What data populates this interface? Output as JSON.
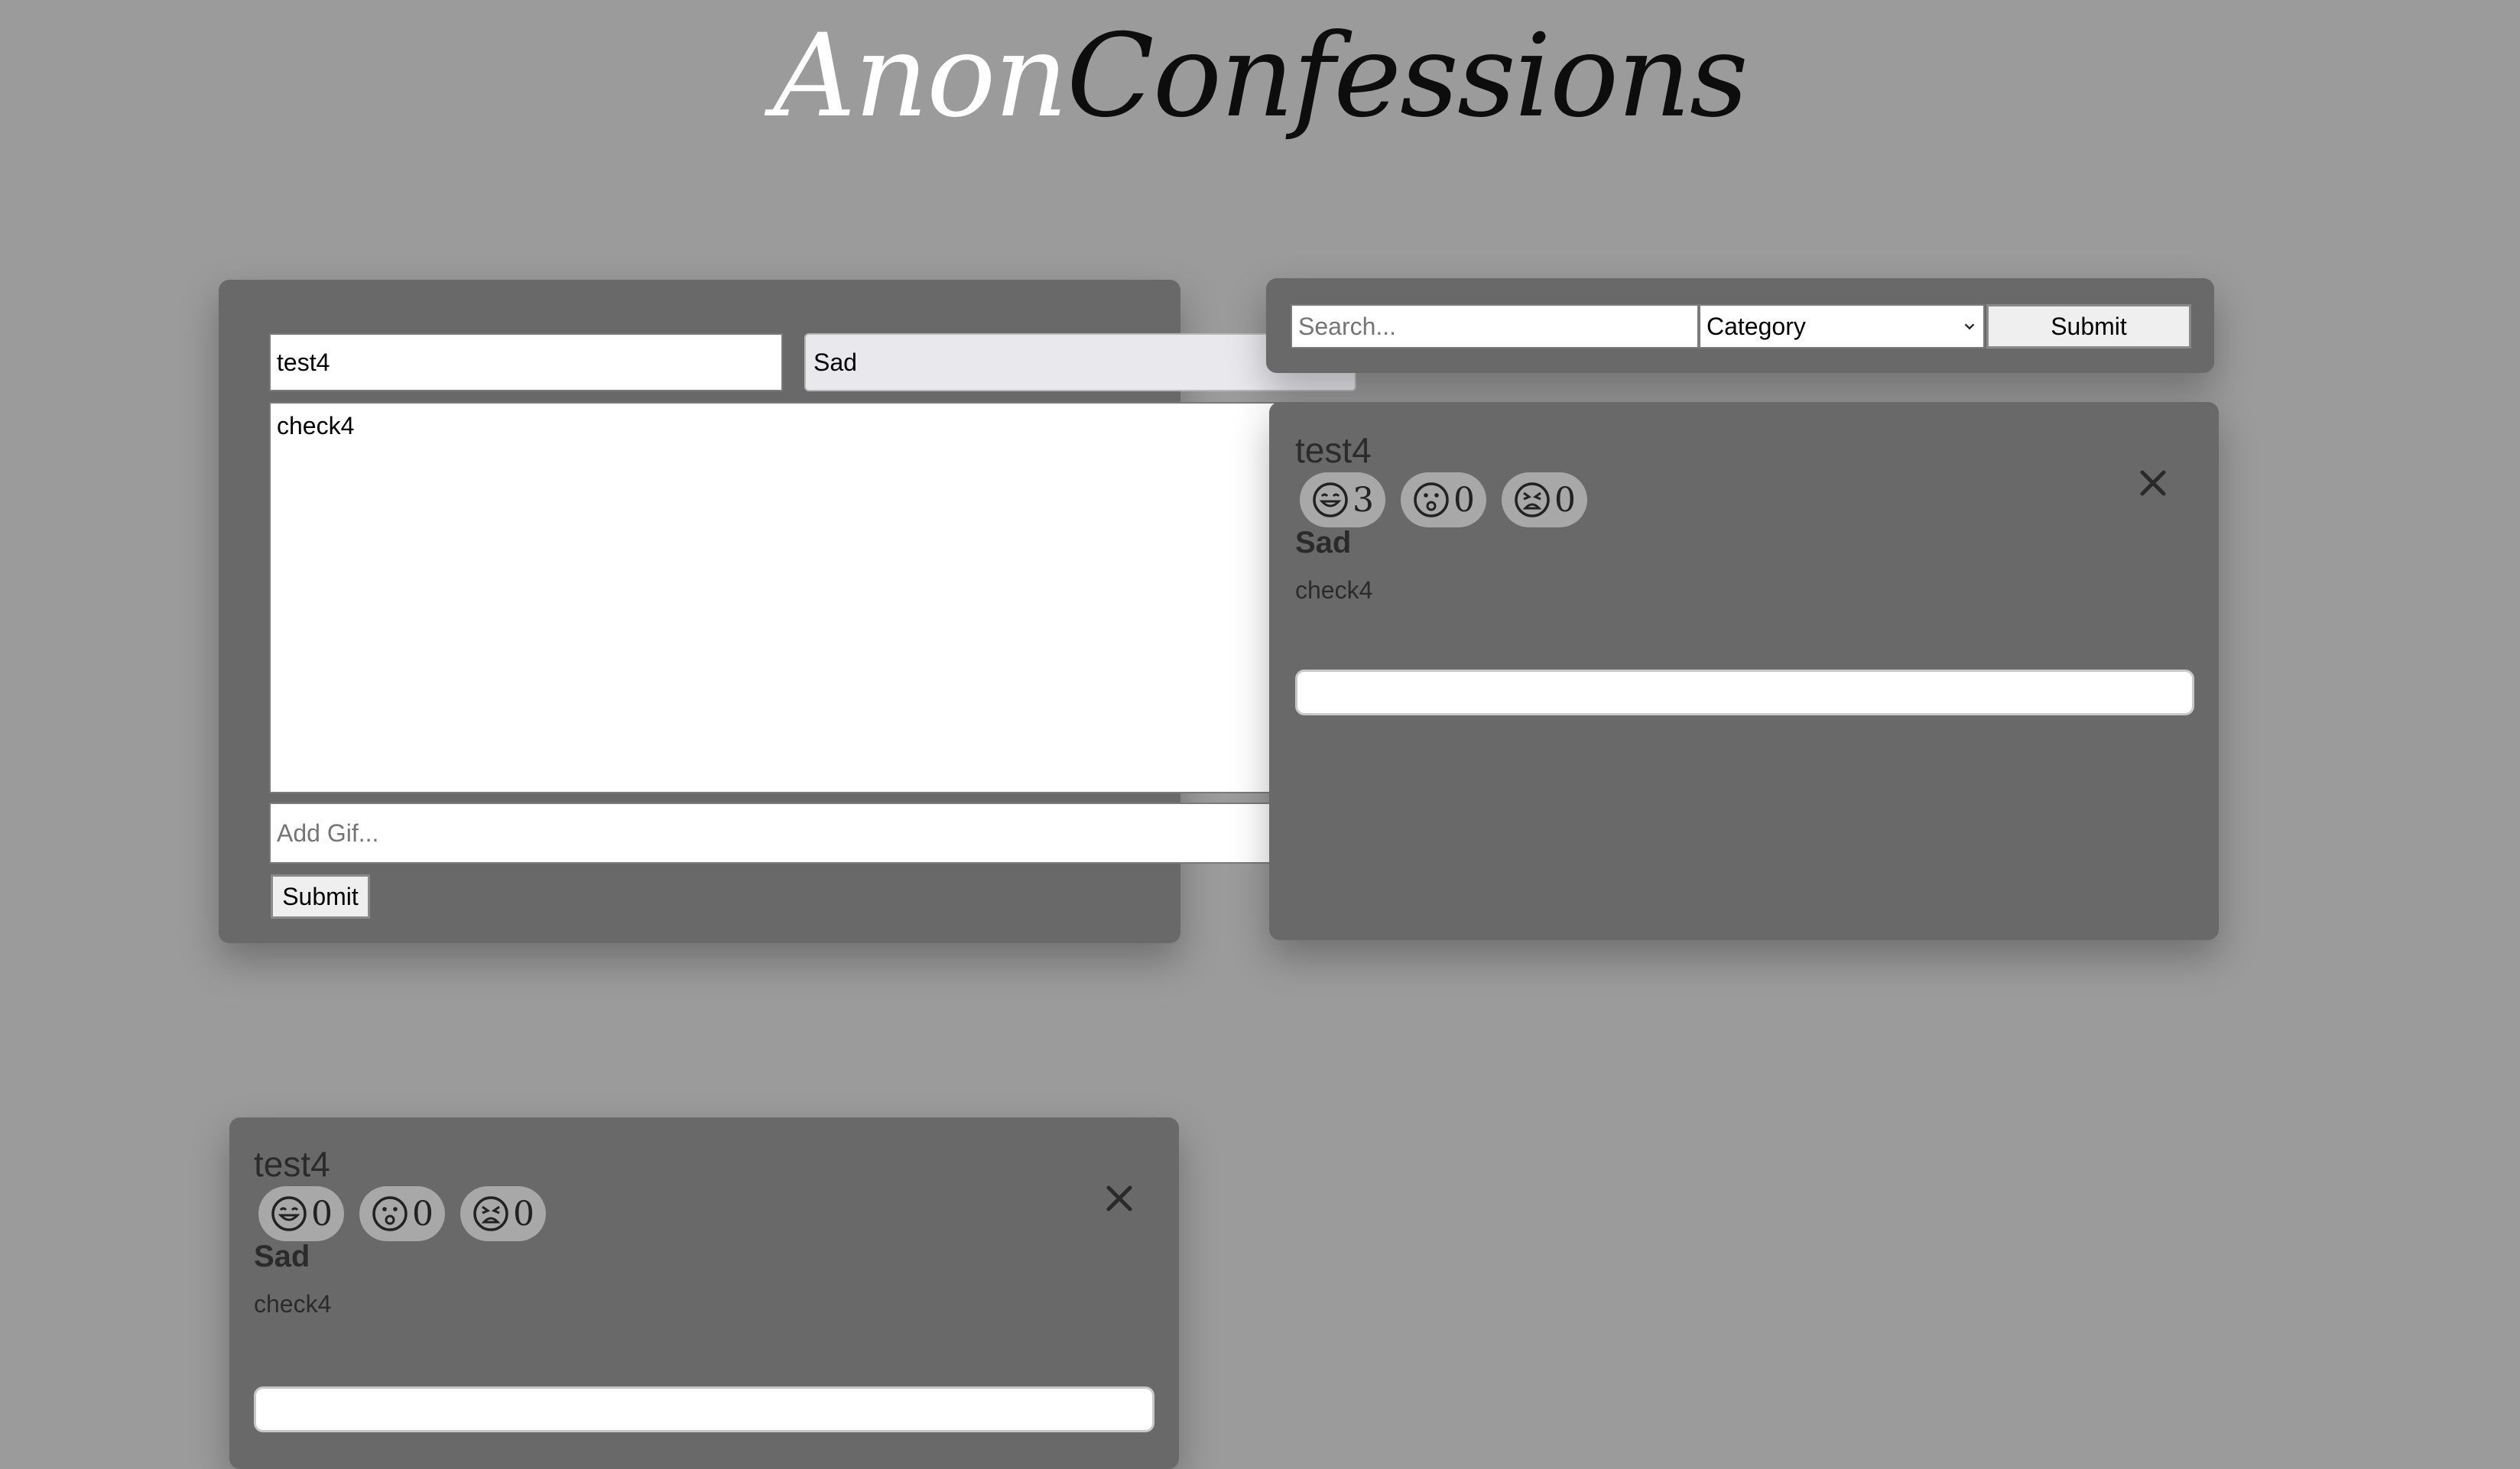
{
  "header": {
    "title_part1": "Anon",
    "title_part2": "Confessions"
  },
  "post_form": {
    "name_value": "test4",
    "category_selected": "Sad",
    "message_value": "check4",
    "gif_placeholder": "Add Gif...",
    "submit_label": "Submit"
  },
  "search_bar": {
    "search_placeholder": "Search...",
    "category_selected": "Category",
    "submit_label": "Submit"
  },
  "posts": [
    {
      "title": "test4",
      "reactions": [
        {
          "icon": "smile-icon",
          "count": "3"
        },
        {
          "icon": "surprised-icon",
          "count": "0"
        },
        {
          "icon": "angry-icon",
          "count": "0"
        }
      ],
      "category": "Sad",
      "text": "check4",
      "comment_value": ""
    },
    {
      "title": "test4",
      "reactions": [
        {
          "icon": "smile-icon",
          "count": "0"
        },
        {
          "icon": "surprised-icon",
          "count": "0"
        },
        {
          "icon": "angry-icon",
          "count": "0"
        }
      ],
      "category": "Sad",
      "text": "check4",
      "comment_value": ""
    }
  ],
  "colors": {
    "background": "#9b9b9b",
    "panel": "#696969",
    "reaction_pill": "#a8a8a8"
  }
}
